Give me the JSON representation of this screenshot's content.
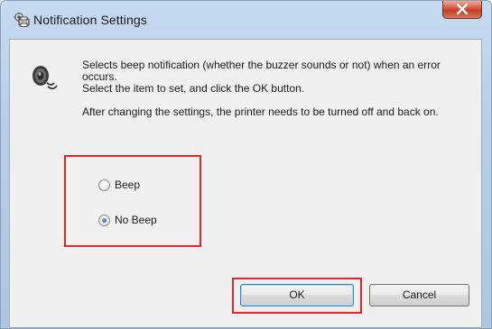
{
  "window": {
    "title": "Notification Settings",
    "icon": "printer-settings-icon",
    "close_icon": "close-icon"
  },
  "content": {
    "icon": "speaker-icon",
    "description_lines": [
      "Selects beep notification (whether the buzzer sounds or not) when an error",
      "occurs.",
      "Select the item to set, and click the OK button."
    ],
    "note": "After changing the settings, the printer needs to be turned off and back on."
  },
  "options": {
    "items": [
      {
        "label": "Beep",
        "selected": false
      },
      {
        "label": "No Beep",
        "selected": true
      }
    ]
  },
  "buttons": {
    "ok_label": "OK",
    "cancel_label": "Cancel"
  },
  "colors": {
    "highlight": "#e32626",
    "radio_selected": "#2a6ac0"
  }
}
